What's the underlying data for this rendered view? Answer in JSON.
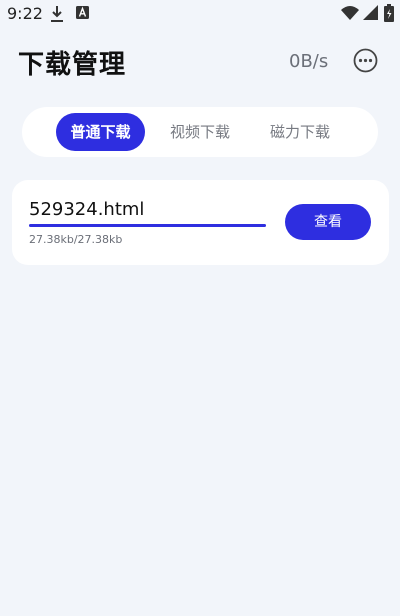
{
  "status_bar": {
    "time": "9:22",
    "icons": [
      "download-icon",
      "a-icon",
      "wifi-icon",
      "signal-icon",
      "battery-icon"
    ]
  },
  "header": {
    "title": "下载管理",
    "speed": "0B/s",
    "more_icon": "more-horizontal-circle-icon"
  },
  "tabs": [
    {
      "label": "普通下载",
      "active": true
    },
    {
      "label": "视频下载",
      "active": false
    },
    {
      "label": "磁力下载",
      "active": false
    }
  ],
  "downloads": [
    {
      "file_name": "529324.html",
      "size_text": "27.38kb/27.38kb",
      "progress": 1.0,
      "action_label": "查看"
    }
  ],
  "colors": {
    "accent": "#2e2ee0",
    "background": "#f2f5fa",
    "card": "#ffffff",
    "muted_text": "#6b6f78"
  }
}
